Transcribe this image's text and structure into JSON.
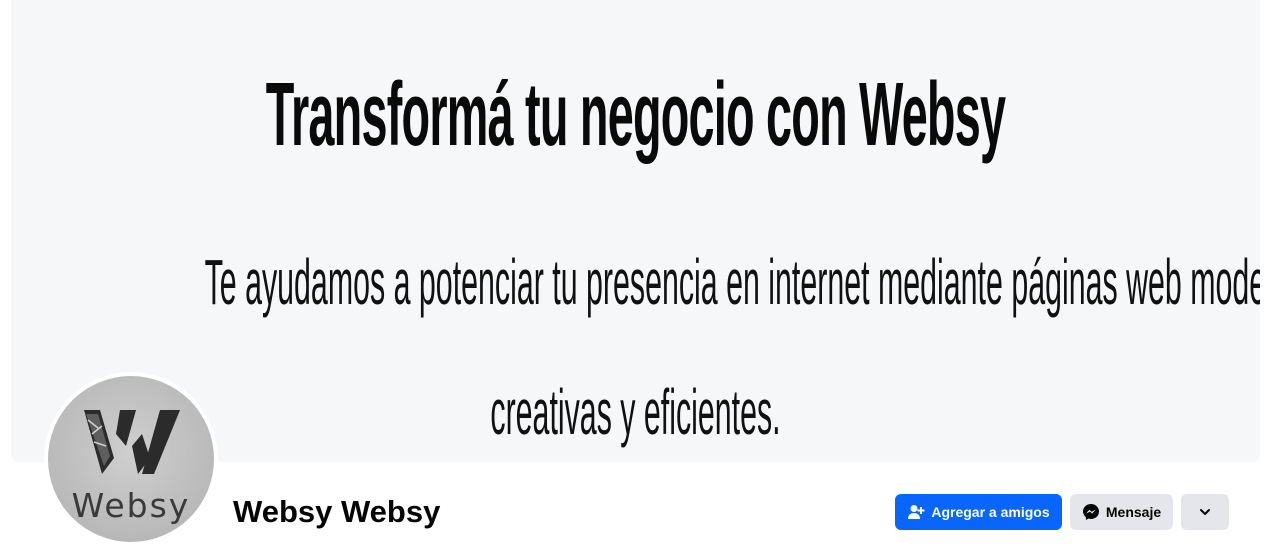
{
  "cover": {
    "headline": "Transformá tu negocio con Websy",
    "subline_1": "Te ayudamos a potenciar tu presencia en internet mediante páginas web modernas,",
    "subline_2": "creativas y eficientes."
  },
  "profile": {
    "name": "Websy Websy",
    "avatar_text": "Websy",
    "avatar_icon": "websy-w-logo"
  },
  "actions": {
    "add_friend_label": "Agregar a amigos",
    "add_friend_icon": "add-friend-icon",
    "message_label": "Mensaje",
    "message_icon": "messenger-icon",
    "more_icon": "chevron-down-icon"
  },
  "colors": {
    "primary": "#0866ff",
    "secondary": "#e4e6eb",
    "cover_bg": "#f6f7f9"
  }
}
